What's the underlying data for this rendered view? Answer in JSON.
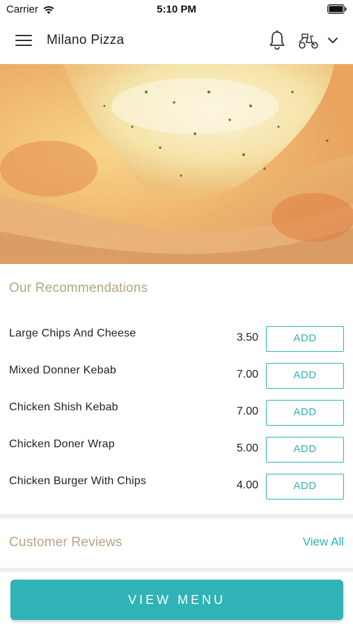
{
  "status_bar": {
    "carrier": "Carrier",
    "time": "5:10 PM"
  },
  "header": {
    "title": "Milano Pizza",
    "icons": [
      "menu-icon",
      "bell-icon",
      "delivery-scooter-icon",
      "chevron-down-icon"
    ]
  },
  "hero": {
    "image": "pizza-photo"
  },
  "recommendations": {
    "title": "Our Recommendations",
    "items": [
      {
        "name": "Large Chips And Cheese",
        "price": "3.50",
        "button": "ADD"
      },
      {
        "name": "Mixed Donner Kebab",
        "price": "7.00",
        "button": "ADD"
      },
      {
        "name": "Chicken Shish Kebab",
        "price": "7.00",
        "button": "ADD"
      },
      {
        "name": "Chicken Doner Wrap",
        "price": "5.00",
        "button": "ADD"
      },
      {
        "name": "Chicken Burger With Chips",
        "price": "4.00",
        "button": "ADD"
      }
    ]
  },
  "reviews": {
    "title": "Customer Reviews",
    "view_all": "View All"
  },
  "footer": {
    "view_menu": "VIEW MENU"
  },
  "colors": {
    "accent": "#2fb3b7",
    "section_title": "#b5a582",
    "divider": "#eeeeee"
  }
}
